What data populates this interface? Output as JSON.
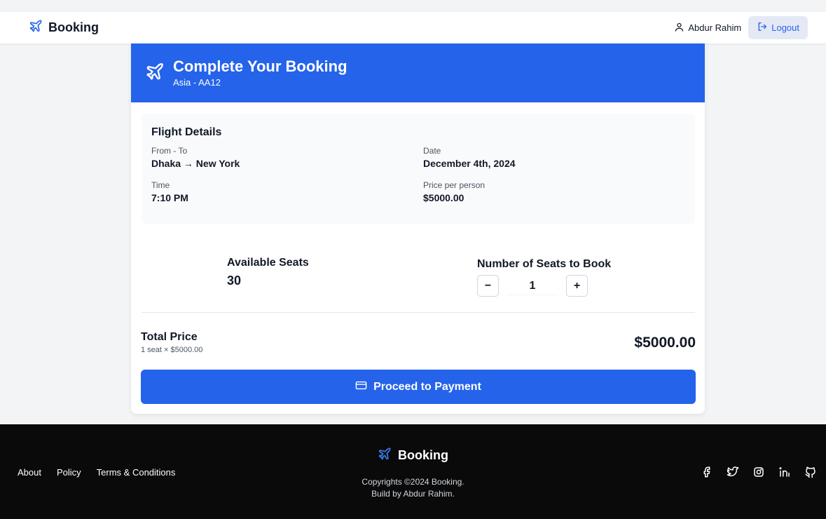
{
  "nav": {
    "brand": "Booking",
    "user_name": "Abdur Rahim",
    "logout_label": "Logout"
  },
  "booking": {
    "title": "Complete Your Booking",
    "subtitle": "Asia - AA12",
    "details_heading": "Flight Details",
    "fields": {
      "from_to_label": "From - To",
      "from_to_value": "Dhaka → New York",
      "date_label": "Date",
      "date_value": "December 4th, 2024",
      "time_label": "Time",
      "time_value": "7:10 PM",
      "price_label": "Price per person",
      "price_value": "$5000.00"
    },
    "available_label": "Available Seats",
    "available_value": "30",
    "seats_label": "Number of Seats to Book",
    "seats_value": "1",
    "minus": "−",
    "plus": "+",
    "total_label": "Total Price",
    "total_breakdown": "1 seat × $5000.00",
    "total_amount": "$5000.00",
    "proceed_label": "Proceed to Payment"
  },
  "footer": {
    "links": [
      "About",
      "Policy",
      "Terms & Conditions"
    ],
    "brand": "Booking",
    "copyright": "Copyrights ©2024 Booking.",
    "credit": "Build by Abdur Rahim.",
    "social_icons": [
      "facebook-icon",
      "twitter-icon",
      "instagram-icon",
      "linkedin-icon",
      "github-icon"
    ]
  },
  "colors": {
    "primary": "#2563eb",
    "footer_bg": "#0a0a0a",
    "page_bg": "#f3f4f6"
  }
}
